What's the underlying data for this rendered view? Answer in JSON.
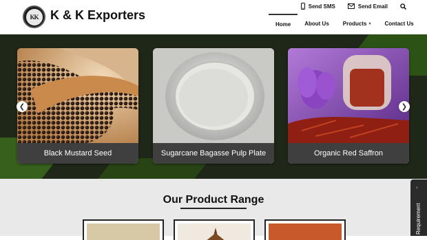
{
  "brand": {
    "logo_text": "KK",
    "name": "K & K Exporters"
  },
  "topbar": {
    "sms_label": "Send SMS",
    "email_label": "Send Email"
  },
  "nav": {
    "home": "Home",
    "about": "About Us",
    "products": "Products",
    "contact": "Contact Us"
  },
  "slider": {
    "prev": "❮",
    "next": "❯",
    "cards": [
      {
        "label": "Black Mustard Seed"
      },
      {
        "label": "Sugarcane Bagasse Pulp Plate"
      },
      {
        "label": "Organic Red Saffron"
      }
    ]
  },
  "section": {
    "title": "Our Product Range"
  },
  "sidebar_tab": {
    "label": "Requirement",
    "caret": "‹"
  },
  "colors": {
    "accent_green": "#3c6b1e",
    "card_label_bg": "#3f3f3f",
    "slider_bg": "#1f2718"
  }
}
